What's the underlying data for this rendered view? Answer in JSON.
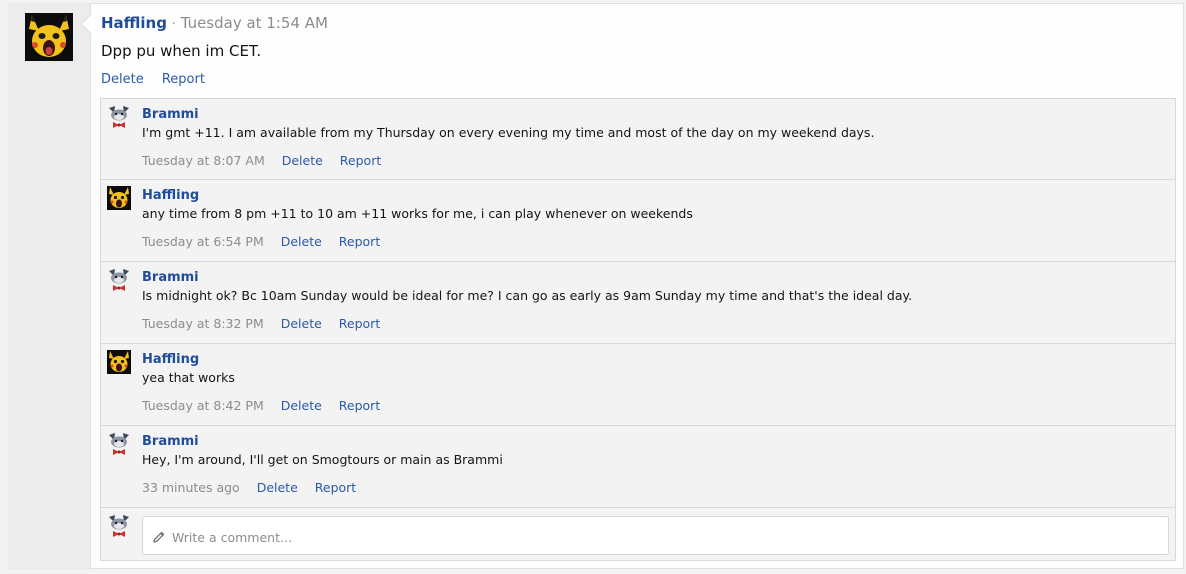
{
  "post": {
    "author": "Haffling",
    "separator": "·",
    "time": "Tuesday at 1:54 AM",
    "body": "Dpp pu when im CET.",
    "actions": {
      "delete": "Delete",
      "report": "Report"
    }
  },
  "comments": [
    {
      "author": "Brammi",
      "avatar": "brammi-avatar",
      "text": "I'm gmt +11. I am available from my Thursday on every evening my time and most of the day on my weekend days.",
      "time": "Tuesday at 8:07 AM",
      "delete": "Delete",
      "report": "Report"
    },
    {
      "author": "Haffling",
      "avatar": "haffling-avatar",
      "text": "any time from 8 pm +11 to 10 am +11 works for me, i can play whenever on weekends",
      "time": "Tuesday at 6:54 PM",
      "delete": "Delete",
      "report": "Report"
    },
    {
      "author": "Brammi",
      "avatar": "brammi-avatar",
      "text": "Is midnight ok? Bc 10am Sunday would be ideal for me? I can go as early as 9am Sunday my time and that's the ideal day.",
      "time": "Tuesday at 8:32 PM",
      "delete": "Delete",
      "report": "Report"
    },
    {
      "author": "Haffling",
      "avatar": "haffling-avatar",
      "text": "yea that works",
      "time": "Tuesday at 8:42 PM",
      "delete": "Delete",
      "report": "Report"
    },
    {
      "author": "Brammi",
      "avatar": "brammi-avatar",
      "text": "Hey, I'm around, I'll get on Smogtours or main as Brammi",
      "time": "33 minutes ago",
      "delete": "Delete",
      "report": "Report"
    }
  ],
  "composer": {
    "placeholder": "Write a comment...",
    "icon": "pencil-icon"
  },
  "colors": {
    "link": "#2c5aa8",
    "username": "#1f4d9c",
    "muted": "#8c8c8c",
    "comment_bg": "#f3f3f3"
  }
}
